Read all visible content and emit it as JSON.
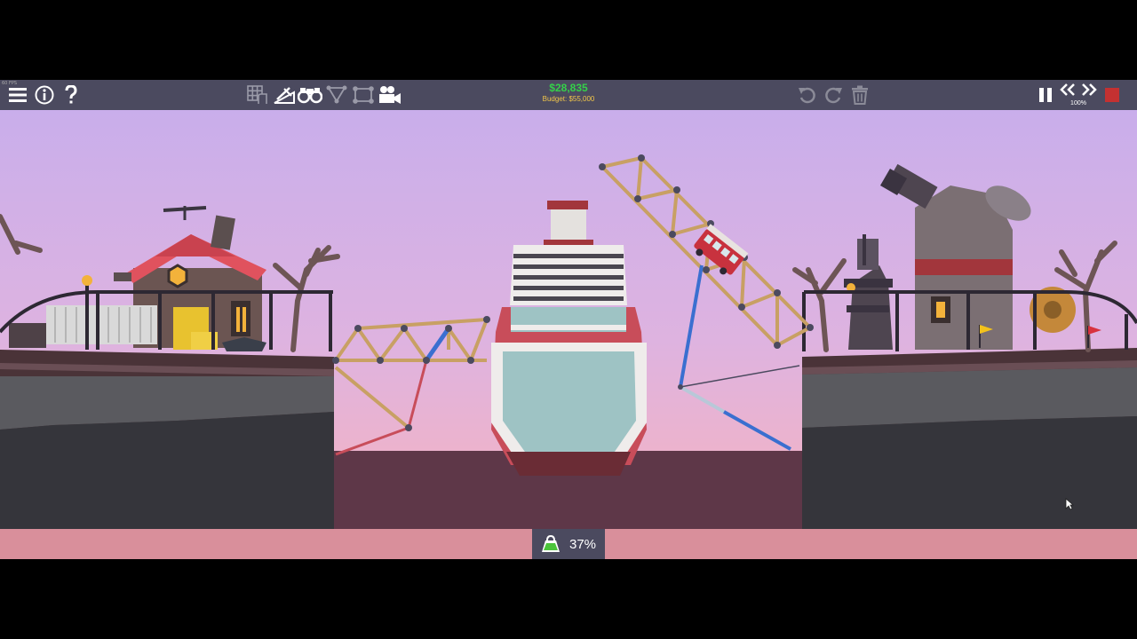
{
  "overlay": {
    "fps": "60 FPS"
  },
  "toolbar": {
    "left_icons": [
      "menu-icon",
      "info-icon",
      "help-icon"
    ],
    "tools": [
      "grid-icon",
      "ramp-icon",
      "binoculars-icon",
      "split-joints-icon",
      "anchor-icon",
      "camera-icon"
    ],
    "edit_icons": [
      "undo-icon",
      "redo-icon",
      "trash-icon"
    ],
    "playback_icons": [
      "pause-icon",
      "slower-icon",
      "faster-icon",
      "stop-icon"
    ]
  },
  "budget": {
    "cash": "$28,835",
    "budget_label": "Budget: $55,000",
    "cash_color": "#35d04a",
    "budget_color": "#f2c64a"
  },
  "simulation": {
    "speed": "100%"
  },
  "stress": {
    "percent": "37%",
    "icon": "weight-icon"
  },
  "colors": {
    "toolbar": "#4b4a5f",
    "sky_top": "#c9aeeb",
    "sky_bottom": "#f3b1c4",
    "water_floor": "#5e3748",
    "ground": "#35353b",
    "bottom_bar": "#d98f9b",
    "stop_button": "#c43131",
    "wood": "#c8a064",
    "steel": "#3a6fd0",
    "rope": "#b8c8d8"
  }
}
